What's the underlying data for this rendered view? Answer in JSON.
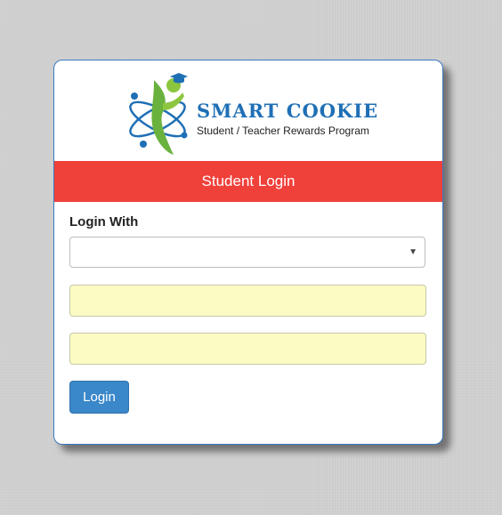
{
  "brand": {
    "name": "SMART COOKIE",
    "tagline": "Student / Teacher Rewards Program",
    "logo_icon": "graduate-atom-logo",
    "name_color": "#1f6fb5"
  },
  "banner": {
    "title": "Student Login",
    "color": "#f0403a"
  },
  "form": {
    "login_with_label": "Login With",
    "login_with_selected": "",
    "dropdown_icon": "caret-down-icon",
    "field_1_value": "",
    "field_2_value": "",
    "field_background": "#fbfbc3",
    "login_button_label": "Login",
    "login_button_color": "#3a87c9"
  },
  "dropdown_arrow_glyph": "▼"
}
